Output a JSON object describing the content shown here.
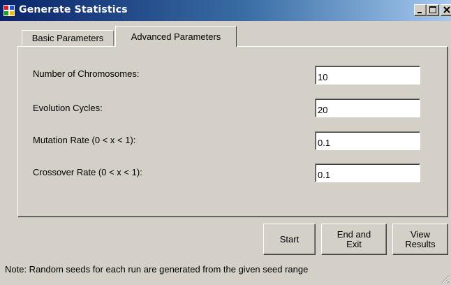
{
  "window": {
    "title": "Generate Statistics",
    "icon": "app-window-icon"
  },
  "tabs": [
    {
      "label": "Basic Parameters",
      "active": false
    },
    {
      "label": "Advanced Parameters",
      "active": true
    }
  ],
  "fields": [
    {
      "label": "Number of Chromosomes:",
      "value": "10"
    },
    {
      "label": "Evolution Cycles:",
      "value": "20"
    },
    {
      "label": "Mutation Rate (0 < x < 1):",
      "value": "0.1"
    },
    {
      "label": "Crossover Rate (0 < x < 1):",
      "value": "0.1"
    }
  ],
  "buttons": {
    "start": "Start",
    "end_exit": "End and\nExit",
    "view_results": "View\nResults"
  },
  "note": "Note: Random seeds for each run are generated from the given seed range",
  "colors": {
    "titlebar_start": "#0a246a",
    "titlebar_end": "#a6caf0",
    "face": "#d4d0c8"
  }
}
